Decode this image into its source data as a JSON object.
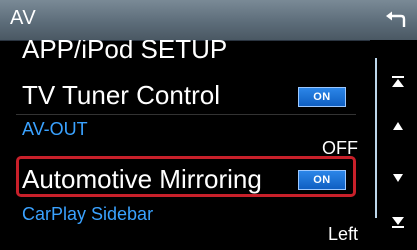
{
  "header": {
    "title": "AV",
    "back_icon": "back-return-icon"
  },
  "items": {
    "app_ipod_setup": {
      "label": "APP/iPod SETUP"
    },
    "tv_tuner_control": {
      "label": "TV Tuner Control",
      "value": "ON"
    },
    "av_out": {
      "label": "AV-OUT",
      "value": "OFF"
    },
    "automotive_mirroring": {
      "label": "Automotive Mirroring",
      "value": "ON"
    },
    "carplay_sidebar": {
      "label": "CarPlay Sidebar",
      "value": "Left"
    }
  },
  "scroll": {
    "icons": [
      "scroll-to-top-icon",
      "scroll-up-icon",
      "scroll-down-icon",
      "scroll-to-bottom-icon"
    ]
  },
  "colors": {
    "header": "#5d6d7a",
    "accent_label": "#3aa2ff",
    "badge": "#1a70d6",
    "highlight": "#c8202a"
  }
}
